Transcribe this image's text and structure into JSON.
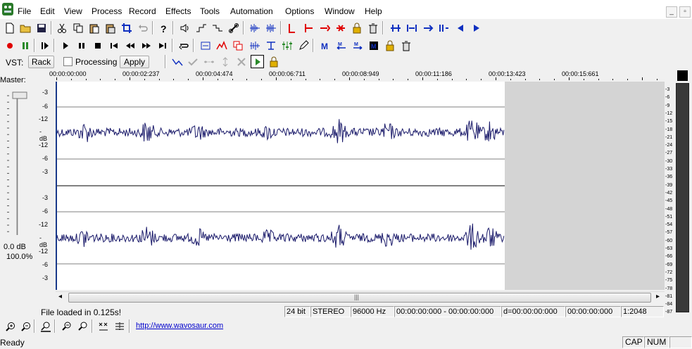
{
  "menu": {
    "items": [
      "File",
      "Edit",
      "View",
      "Process",
      "Record",
      "Effects",
      "Tools",
      "Automation",
      "Options",
      "Window",
      "Help"
    ]
  },
  "vst": {
    "label": "VST:",
    "rack_label": "Rack",
    "processing_label": "Processing",
    "apply_label": "Apply"
  },
  "ruler": {
    "ticks": [
      "00:00:00:000",
      "00:00:02:237",
      "00:00:04:474",
      "00:00:06:711",
      "00:00:08:949",
      "00:00:11:186",
      "00:00:13:423",
      "00:00:15:661"
    ]
  },
  "master": {
    "label": "Master:",
    "db_value": "0.0 dB",
    "percent": "100.0%"
  },
  "wave_scale": {
    "top_channel": [
      "-3",
      "-6",
      "-12",
      "-dB",
      "-12",
      "-6",
      "-3"
    ],
    "bottom_channel": [
      "-3",
      "-6",
      "-12",
      "-dB",
      "-12",
      "-6",
      "-3"
    ]
  },
  "meter_scale": [
    "-3",
    "-6",
    "-9",
    "-12",
    "-15",
    "-18",
    "-21",
    "-24",
    "-27",
    "-30",
    "-33",
    "-36",
    "-39",
    "-42",
    "-45",
    "-48",
    "-51",
    "-54",
    "-57",
    "-60",
    "-63",
    "-66",
    "-69",
    "-72",
    "-75",
    "-78",
    "-81",
    "-84",
    "-87"
  ],
  "info": {
    "message": "File loaded in 0.125s!",
    "bit_depth": "24 bit",
    "channels": "STEREO",
    "sample_rate": "96000 Hz",
    "selection": "00:00:00:000 - 00:00:00:000",
    "duration": "d=00:00:00:000",
    "cursor": "00:00:00:000",
    "zoom_ratio": "1:2048"
  },
  "zoom_bar": {
    "link": "http://www.wavosaur.com"
  },
  "status": {
    "text": "Ready",
    "cap": "CAP",
    "num": "NUM"
  },
  "colors": {
    "waveform": "#1a1a6a",
    "unloaded_region": "#d4d4d4",
    "accent_blue": "#1030c0",
    "record_red": "#e00000"
  }
}
